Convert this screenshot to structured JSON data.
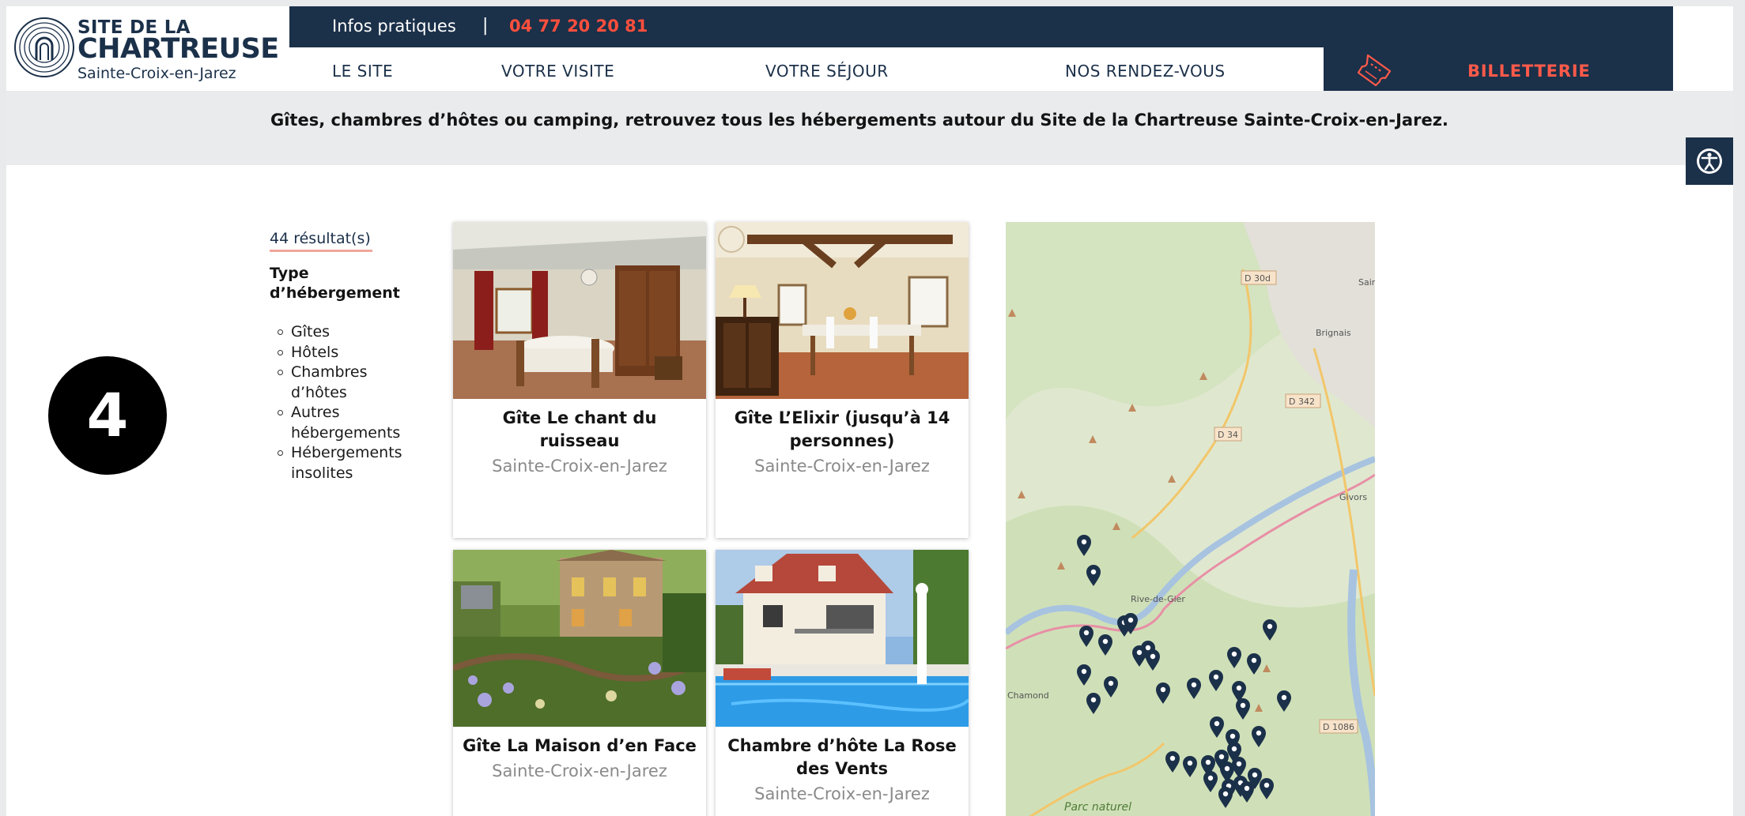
{
  "header": {
    "logo": {
      "line1": "SITE DE LA",
      "line2": "CHARTREUSE",
      "line3": "Sainte-Croix-en-Jarez"
    },
    "topbar": {
      "info_label": "Infos pratiques",
      "separator": "|",
      "phone": "04 77 20 20 81"
    },
    "nav": [
      "LE SITE",
      "VOTRE VISITE",
      "VOTRE SÉJOUR",
      "NOS RENDEZ-VOUS"
    ],
    "ticketing": {
      "label": "BILLETTERIE",
      "icon": "ticket-icon"
    }
  },
  "intro": "Gîtes, chambres d’hôtes ou camping, retrouvez tous les hébergements autour du Site de la Chartreuse Sainte-Croix-en-Jarez.",
  "step_marker": "4",
  "filters": {
    "results": "44 résultat(s)",
    "title": "Type d’hébergement",
    "options": [
      "Gîtes",
      "Hôtels",
      "Chambres d’hôtes",
      "Autres hébergements",
      "Hébergements insolites"
    ]
  },
  "cards": [
    {
      "title": "Gîte Le chant du ruisseau",
      "city": "Sainte-Croix-en-Jarez"
    },
    {
      "title": "Gîte L’Elixir (jusqu’à 14 personnes)",
      "city": "Sainte-Croix-en-Jarez"
    },
    {
      "title": "Gîte La Maison d’en Face",
      "city": "Sainte-Croix-en-Jarez"
    },
    {
      "title": "Chambre d’hôte La Rose des Vents",
      "city": "Sainte-Croix-en-Jarez"
    }
  ],
  "map": {
    "labels": [
      "D 30d",
      "Brignais",
      "D 342",
      "D 34",
      "Givors",
      "Rive-de-Gier",
      "Chamond",
      "D 1086",
      "Parc naturel",
      "Sair"
    ],
    "marker_icon": "map-pin-icon"
  },
  "accessibility": {
    "icon": "accessibility-icon"
  },
  "colors": {
    "navy": "#1b3049",
    "accent": "#ff4f3d"
  }
}
